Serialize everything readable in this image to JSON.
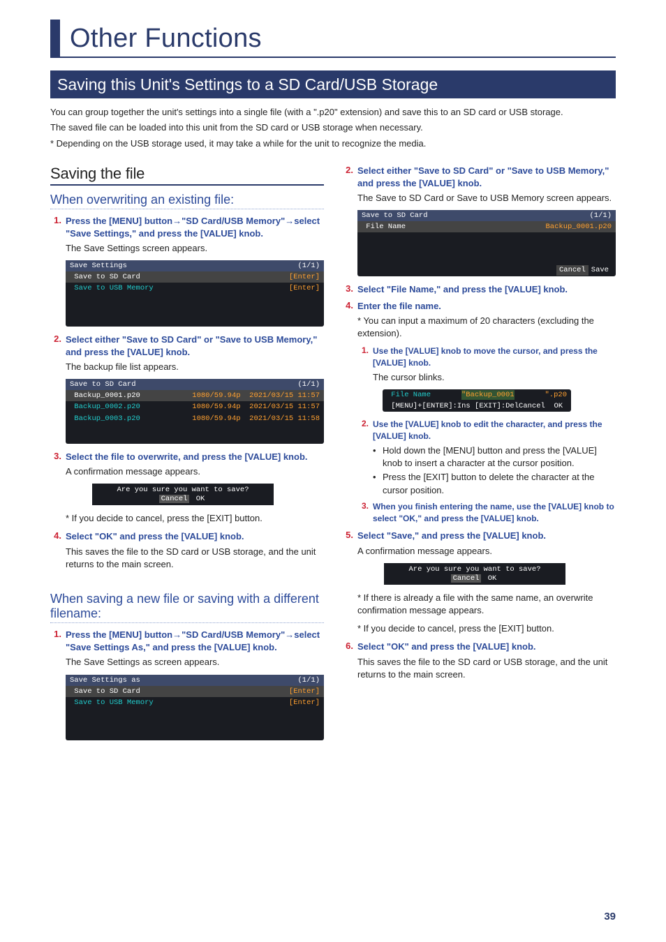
{
  "page_number": "39",
  "title": "Other Functions",
  "section": "Saving this Unit's Settings to a SD Card/USB Storage",
  "intro": {
    "p1": "You can group together the unit's settings into a single file (with a \".p20\" extension) and save this to an SD card or USB storage.",
    "p2": "The saved file can be loaded into this unit from the SD card or USB storage when necessary.",
    "note": "Depending on the USB storage used, it may take a while for the unit to recognize the media."
  },
  "left": {
    "h2": "Saving the file",
    "h3a": "When overwriting an existing file:",
    "step1": "Press the [MENU] button→\"SD Card/USB Memory\"→select \"Save Settings,\" and press the [VALUE] knob.",
    "step1_body": "The Save Settings screen appears.",
    "scr1": {
      "title_l": "Save Settings",
      "title_r": "(1/1)",
      "r1_l": " Save to SD Card",
      "r1_r": "[Enter]",
      "r2_l": " Save to USB Memory",
      "r2_r": "[Enter]"
    },
    "step2": "Select either \"Save to SD Card\" or \"Save to USB Memory,\" and press the [VALUE] knob.",
    "step2_body": "The backup file list appears.",
    "scr2": {
      "title_l": "Save to SD Card",
      "title_r": "(1/1)",
      "r1_l": " Backup_0001.p20",
      "r1_r": "1080/59.94p  2021/03/15 11:57",
      "r2_l": " Backup_0002.p20",
      "r2_r": "1080/59.94p  2021/03/15 11:57",
      "r3_l": " Backup_0003.p20",
      "r3_r": "1080/59.94p  2021/03/15 11:58"
    },
    "step3": "Select the file to overwrite, and press the [VALUE] knob.",
    "step3_body": "A confirmation message appears.",
    "dlg1": {
      "msg": "Are you sure you want to save?",
      "b1": "Cancel",
      "b2": "OK"
    },
    "step3_note": "If you decide to cancel, press the [EXIT] button.",
    "step4": "Select \"OK\" and press the [VALUE] knob.",
    "step4_body": "This saves the file to the SD card or USB storage, and the unit returns to the main screen.",
    "h3b": "When saving a new file or saving with a different filename:",
    "b_step1": "Press the [MENU] button→\"SD Card/USB Memory\"→select \"Save Settings As,\" and press the [VALUE] knob.",
    "b_step1_body": "The Save Settings as screen appears.",
    "scr3": {
      "title_l": "Save Settings as",
      "title_r": "(1/1)",
      "r1_l": " Save to SD Card",
      "r1_r": "[Enter]",
      "r2_l": " Save to USB Memory",
      "r2_r": "[Enter]"
    }
  },
  "right": {
    "step2": "Select either \"Save to SD Card\" or \"Save to USB Memory,\" and press the [VALUE] knob.",
    "step2_body": "The Save to SD Card or Save to USB Memory screen appears.",
    "scr4": {
      "title_l": "Save to SD Card",
      "title_r": "(1/1)",
      "r1_l": " File Name",
      "r1_r": "Backup_0001.p20",
      "f1": "Cancel",
      "f2": "Save"
    },
    "step3": "Select \"File Name,\" and press the [VALUE] knob.",
    "step4": "Enter the file name.",
    "step4_note": "You can input a maximum of 20 characters (excluding the extension).",
    "sub1": "Use the [VALUE] knob to move the cursor, and press the [VALUE] knob.",
    "sub1_body": "The cursor blinks.",
    "scr5": {
      "r1_l": " File Name",
      "r1_m": "\"Backup_0001",
      "r1_r": "\".p20",
      "r2_l": " [MENU]+[ENTER]:Ins [EXIT]:Del",
      "r2_r": "Cancel  OK "
    },
    "sub2": "Use the [VALUE] knob to edit the character, and press the [VALUE] knob.",
    "sub2_b1": "Hold down the [MENU] button and press the [VALUE] knob to insert a character at the cursor position.",
    "sub2_b2": "Press the [EXIT] button to delete the character at the cursor position.",
    "sub3": "When you finish entering the name, use the [VALUE] knob to select \"OK,\" and press the [VALUE] knob.",
    "step5": "Select \"Save,\" and press the [VALUE] knob.",
    "step5_body": "A confirmation message appears.",
    "dlg2": {
      "msg": "Are you sure you want to save?",
      "b1": "Cancel",
      "b2": "OK"
    },
    "step5_n1": "If there is already a file with the same name, an overwrite confirmation message appears.",
    "step5_n2": "If you decide to cancel, press the [EXIT] button.",
    "step6": "Select \"OK\" and press the [VALUE] knob.",
    "step6_body": "This saves the file to the SD card or USB storage, and the unit returns to the main screen."
  }
}
